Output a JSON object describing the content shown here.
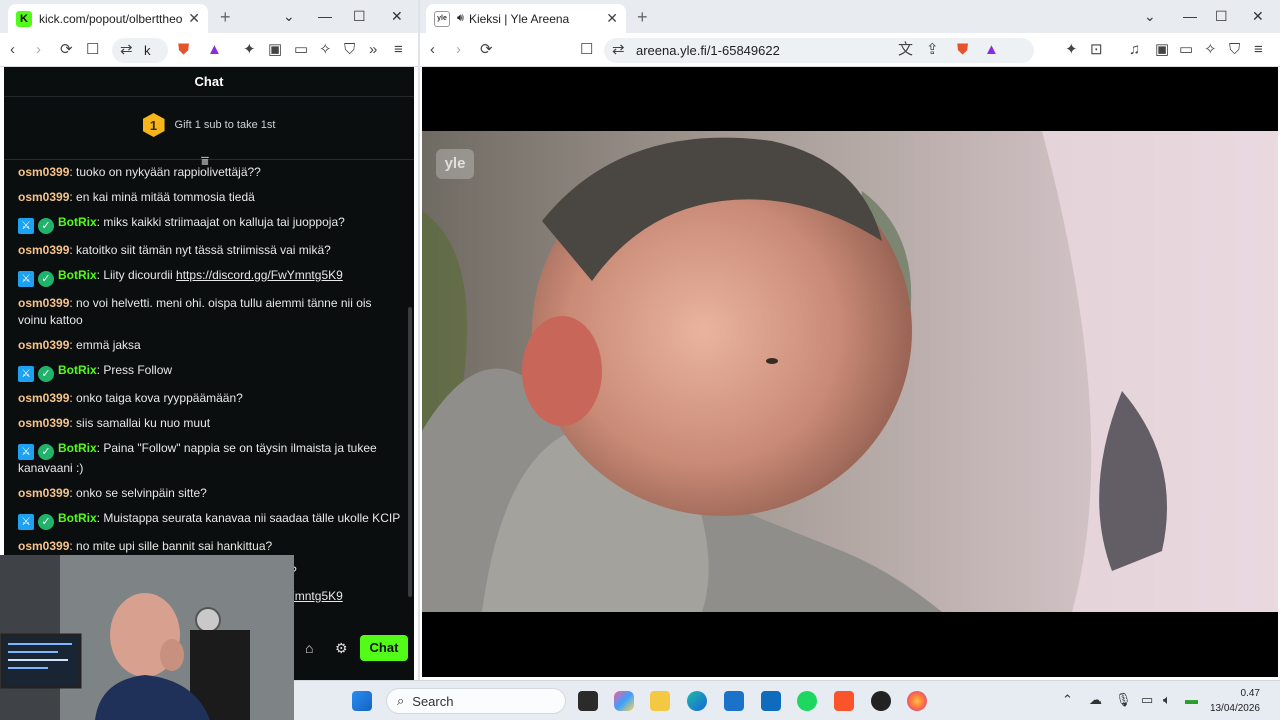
{
  "left_window": {
    "tab_title": "kick.com/popout/olberttheoverseer/chat",
    "tab_favicon": "K",
    "url_text": "k"
  },
  "right_window": {
    "tab_title": "Kieksi | Yle Areena",
    "url": "areena.yle.fi/1-65849622",
    "favicon_text": "yle",
    "watermark": "yle"
  },
  "chat": {
    "title": "Chat",
    "gift_rank": "1",
    "gift_text": "Gift 1 sub to take 1st",
    "send_label": "Chat",
    "messages": [
      {
        "user": "osm0399",
        "text": "tuoko on nykyään rappiolivettäjä??"
      },
      {
        "user": "osm0399",
        "text": "en kai minä mitää tommosia tiedä"
      },
      {
        "user": "BotRix",
        "text": "miks kaikki striimaajat on kalluja tai juoppoja?"
      },
      {
        "user": "osm0399",
        "text": "katoitko siit tämän nyt tässä striimissä vai mikä?"
      },
      {
        "user": "BotRix",
        "text": "Liity dicourdii ",
        "link": "https://discord.gg/FwYmntg5K9"
      },
      {
        "user": "osm0399",
        "text": "no voi helvetti. meni ohi. oispa tullu aiemmi tänne nii ois voinu kattoo"
      },
      {
        "user": "osm0399",
        "text": "emmä jaksa"
      },
      {
        "user": "BotRix",
        "text": "Press Follow"
      },
      {
        "user": "osm0399",
        "text": "onko taiga kova ryyppäämään?"
      },
      {
        "user": "osm0399",
        "text": "siis samallai ku nuo muut"
      },
      {
        "user": "BotRix",
        "text": "Paina \"Follow\" nappia se on täysin ilmaista ja tukee kanavaani :)"
      },
      {
        "user": "osm0399",
        "text": "onko se selvinpäin sitte?"
      },
      {
        "user": "BotRix",
        "text": "Muistappa seurata kanavaa nii saadaa tälle ukolle KCIP"
      },
      {
        "user": "osm0399",
        "text": "no mite upi sille bannit sai hankittua?"
      },
      {
        "user": "osm0399",
        "text": "mitä pitää tehdä että saa kieksin bannit??"
      },
      {
        "user": "BotRix",
        "text": "Liity dicourdii ",
        "link": "https://discord.gg/FwYmntg5K9"
      }
    ]
  },
  "taskbar": {
    "search_placeholder": "Search",
    "time": "0.47",
    "date": "13/04/2026"
  },
  "colors": {
    "kick_green": "#53fc18",
    "chat_bg": "#0b0e0f",
    "username": "#f6c48a"
  }
}
